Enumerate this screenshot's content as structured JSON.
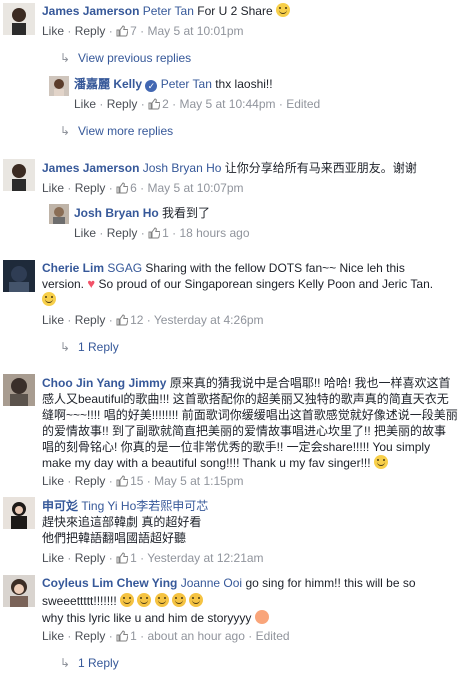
{
  "ui": {
    "like": "Like",
    "reply": "Reply",
    "dot": "·",
    "view_previous": "View previous replies",
    "view_more": "View more replies",
    "one_reply": "1 Reply"
  },
  "comments": [
    {
      "name": "James Jamerson",
      "mention": "Peter Tan",
      "text": "For U 2 Share",
      "likes": "7",
      "time": "May 5 at 10:01pm"
    },
    {
      "name": "潘嘉麗 Kelly",
      "mention": "Peter Tan",
      "text": "thx laoshi!!",
      "likes": "2",
      "time": "May 5 at 10:44pm",
      "edited": "Edited"
    },
    {
      "name": "James Jamerson",
      "mention": "Josh Bryan Ho",
      "text": "让你分享给所有马来西亚朋友。谢谢",
      "likes": "6",
      "time": "May 5 at 10:07pm"
    },
    {
      "name": "Josh Bryan Ho",
      "text": "我看到了",
      "likes": "1",
      "time": "18 hours ago"
    },
    {
      "name": "Cherie Lim",
      "mention": "SGAG",
      "text_lines": [
        "Sharing with the fellow DOTS fan~~ Nice leh this",
        "version.",
        "So proud of our Singaporean singers Kelly Poon and Jeric Tan."
      ],
      "likes": "12",
      "time": "Yesterday at 4:26pm"
    },
    {
      "name": "Choo Jin Yang Jimmy",
      "text_lines": [
        "原来真的猜我说中是合唱耶!! 哈哈! 我也一样喜欢这首",
        "感人又beautiful的歌曲!!! 这首歌搭配你的超美丽又独特的歌声真的简直天衣无",
        "缝啊~~~!!!! 唱的好美!!!!!!!! 前面歌词你缓缓唱出这首歌感觉就好像述说一段美丽",
        "的爱情故事!! 到了副歌就简直把美丽的爱情故事唱进心坎里了!! 把美丽的故事",
        "唱的刻骨铭心! 你真的是一位非常优秀的歌手!! 一定会share!!!!! You simply",
        "make my day with a beautiful song!!!! Thank u my fav singer!!!"
      ],
      "likes": "15",
      "time": "May 5 at 1:15pm"
    },
    {
      "name": "申可彣",
      "mention": "Ting Yi Ho李若熙申可芯",
      "text_lines": [
        "趕快來追這部韓劇 真的超好看",
        "他們把韓語翻唱國語超好聽"
      ],
      "likes": "1",
      "time": "Yesterday at 12:21am"
    },
    {
      "name": "Coyleus Lim Chew Ying",
      "mention": "Joanne Ooi",
      "text_lines": [
        "go sing for himm!! this will be so",
        "sweeettttt!!!!!!!",
        "why this lyric like u and him de storyyyy"
      ],
      "likes": "1",
      "time": "about an hour ago",
      "edited": "Edited"
    }
  ]
}
